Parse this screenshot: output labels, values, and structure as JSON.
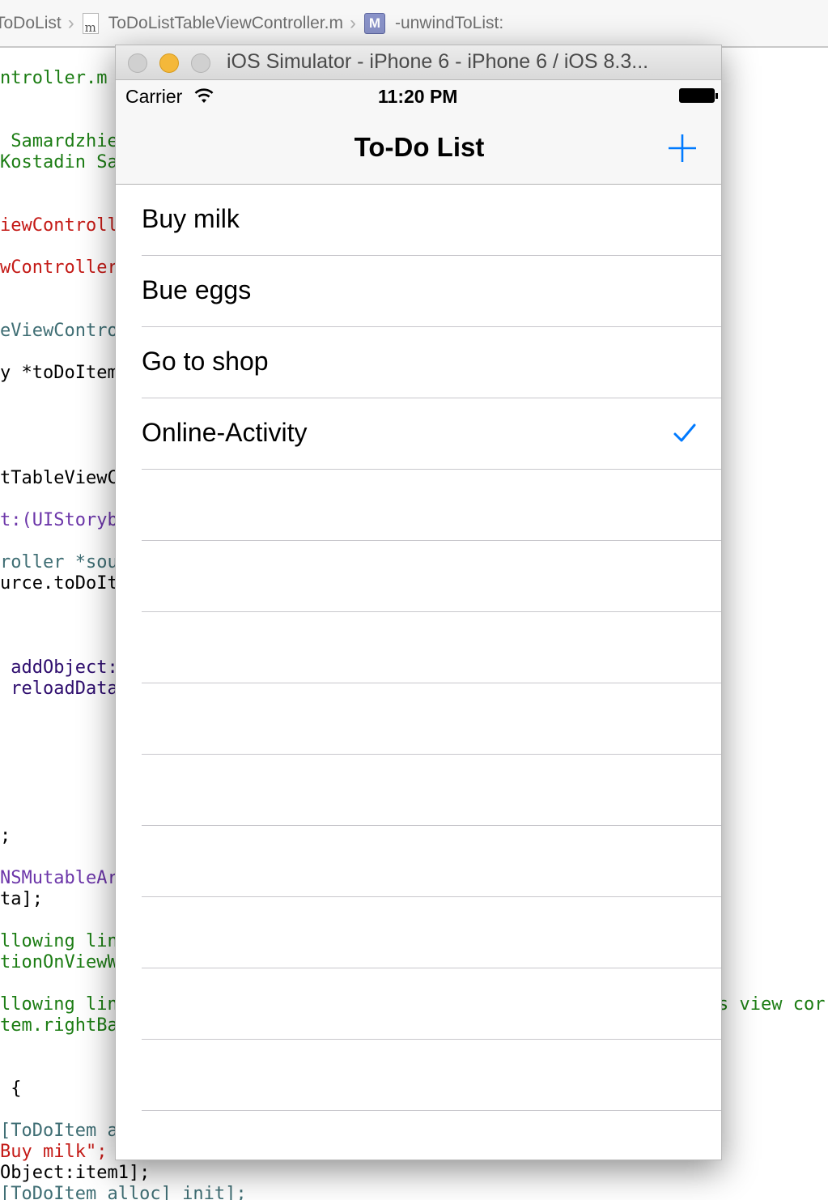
{
  "jumpbar": {
    "crumbs": [
      "ToDoList",
      "ToDoListTableViewController.m",
      "-unwindToList:"
    ],
    "file_icon_glyph": "m",
    "method_icon_glyph": "M"
  },
  "code_lines": [
    {
      "text": "ntroller.m",
      "color": "green"
    },
    {
      "text": " Samardzhiev",
      "color": "green"
    },
    {
      "text": "Kostadin Sa",
      "color": "green"
    },
    {
      "text": "iewControlle",
      "color": "red"
    },
    {
      "text": "wController",
      "color": "red"
    },
    {
      "text": "eViewContro",
      "color": "teal"
    },
    {
      "text": "y *toDoItem",
      "color": "black"
    },
    {
      "text": "tTableViewCo",
      "color": "black"
    },
    {
      "text": "t:(UIStoryb",
      "color": "purple"
    },
    {
      "text": "roller *sou",
      "color": "teal"
    },
    {
      "text": "urce.toDoIt",
      "color": "black"
    },
    {
      "text": " addObject:",
      "color": "navy"
    },
    {
      "text": " reloadData",
      "color": "navy"
    },
    {
      "text": ";",
      "color": "black"
    },
    {
      "text": "NSMutableAr",
      "color": "purple"
    },
    {
      "text": "ta];",
      "color": "black"
    },
    {
      "text": "llowing lin",
      "color": "green"
    },
    {
      "text": "tionOnViewW",
      "color": "green"
    },
    {
      "text": "llowing lin",
      "color": "green"
    },
    {
      "text": "tem.rightBa",
      "color": "green"
    },
    {
      "text": "s view cor",
      "color": "green"
    },
    {
      "text": " {",
      "color": "black"
    },
    {
      "text": "[ToDoItem a",
      "color": "teal"
    },
    {
      "text": "Buy milk\";",
      "color": "red"
    },
    {
      "text": "Object:item1];",
      "color": "black"
    },
    {
      "text": "[ToDoItem alloc] init];",
      "color": "teal"
    }
  ],
  "simulator": {
    "window_title": "iOS Simulator - iPhone 6 - iPhone 6 / iOS 8.3...",
    "status": {
      "carrier": "Carrier",
      "time": "11:20 PM"
    },
    "nav": {
      "title": "To-Do List",
      "add_icon": "plus-icon"
    },
    "items": [
      {
        "label": "Buy milk",
        "checked": false
      },
      {
        "label": "Bue eggs",
        "checked": false
      },
      {
        "label": "Go to shop",
        "checked": false
      },
      {
        "label": "Online-Activity",
        "checked": true
      }
    ],
    "accent_color": "#007aff"
  }
}
